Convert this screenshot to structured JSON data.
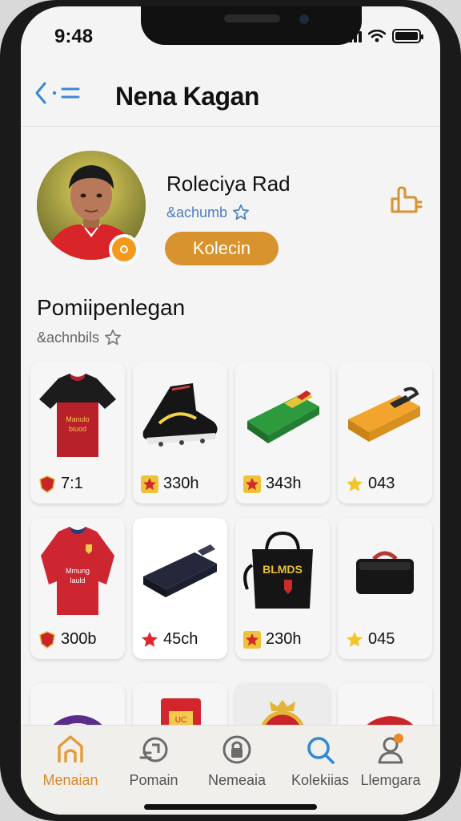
{
  "status_bar": {
    "time": "9:48"
  },
  "header": {
    "title": "Nena Kagan"
  },
  "profile": {
    "name": "Roleciya Rad",
    "handle": "&achumb",
    "collection_button": "Kolecin"
  },
  "section": {
    "title": "Pomiipenlegan",
    "subtitle": "&achnbils"
  },
  "items": [
    {
      "price": "7:1",
      "badge": "crest",
      "image": "jersey-black-red"
    },
    {
      "price": "330h",
      "badge": "star-red",
      "image": "football-boot"
    },
    {
      "price": "343h",
      "badge": "star-red",
      "image": "green-scarf-bag"
    },
    {
      "price": "043",
      "badge": "star-gold",
      "image": "yellow-case"
    },
    {
      "price": "300b",
      "badge": "crest",
      "image": "jersey-red"
    },
    {
      "price": "45ch",
      "badge": "star-red",
      "image": "navy-wallet"
    },
    {
      "price": "230h",
      "badge": "star-red",
      "image": "black-tote-bag"
    },
    {
      "price": "045",
      "badge": "star-gold",
      "image": "black-pouch"
    },
    {
      "price": "",
      "badge": "",
      "image": "round-logo"
    },
    {
      "price": "",
      "badge": "",
      "image": "red-box"
    },
    {
      "price": "",
      "badge": "",
      "image": "club-crest"
    },
    {
      "price": "",
      "badge": "",
      "image": "red-cap"
    }
  ],
  "tabs": [
    {
      "label": "Menaian",
      "icon": "home-icon",
      "active": true
    },
    {
      "label": "Pomain",
      "icon": "ticket-icon",
      "active": false
    },
    {
      "label": "Nemeaia",
      "icon": "lock-icon",
      "active": false
    },
    {
      "label": "Kolekiias",
      "icon": "search-icon",
      "active": false
    },
    {
      "label": "Llemgara",
      "icon": "profile-icon",
      "active": false
    }
  ],
  "colors": {
    "accent": "#d8922e",
    "link": "#4a7fc0",
    "search_blue": "#2f8ad8"
  }
}
